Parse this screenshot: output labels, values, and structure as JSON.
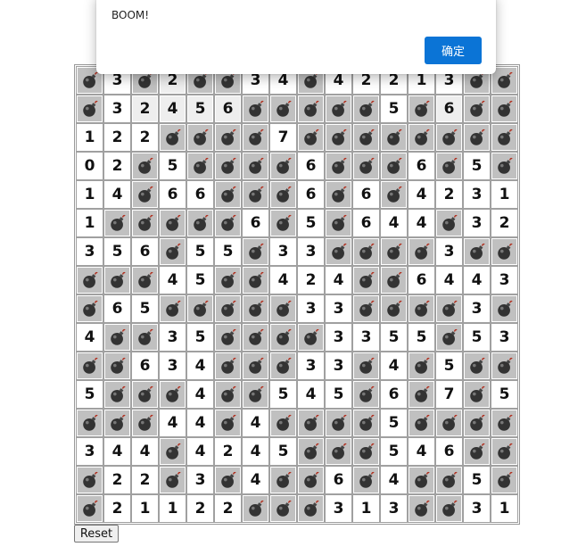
{
  "dialog": {
    "message": "BOOM!",
    "ok_label": "确定"
  },
  "reset_label": "Reset",
  "colors": {
    "bomb_bg": "#c0c0c0",
    "number_bg": "#ffffff",
    "ok_button": "#0b74d6"
  },
  "icons": {
    "bomb": "bomb-icon"
  },
  "board": {
    "rows": [
      [
        "B",
        "3",
        "B",
        "2",
        "B",
        "B",
        "3",
        "4",
        "B",
        "4",
        "2",
        "2",
        "1",
        "3",
        "B",
        "B"
      ],
      [
        "B",
        "3",
        "2",
        "4",
        "5",
        "6",
        "B",
        "B",
        "B",
        "B",
        "B",
        "5",
        "B",
        "6",
        "B",
        "B"
      ],
      [
        "1",
        "2",
        "2",
        "B",
        "B",
        "B",
        "B",
        "7",
        "B",
        "B",
        "B",
        "B",
        "B",
        "B",
        "B",
        "B"
      ],
      [
        "0",
        "2",
        "B",
        "5",
        "B",
        "B",
        "B",
        "B",
        "6",
        "B",
        "B",
        "B",
        "6",
        "B",
        "5",
        "B"
      ],
      [
        "1",
        "4",
        "B",
        "6",
        "6",
        "B",
        "B",
        "B",
        "6",
        "B",
        "6",
        "B",
        "4",
        "2",
        "3",
        "1"
      ],
      [
        "1",
        "B",
        "B",
        "B",
        "B",
        "B",
        "6",
        "B",
        "5",
        "B",
        "6",
        "4",
        "4",
        "B",
        "3",
        "2"
      ],
      [
        "3",
        "5",
        "6",
        "B",
        "5",
        "5",
        "B",
        "3",
        "3",
        "B",
        "B",
        "B",
        "B",
        "3",
        "B",
        "B"
      ],
      [
        "B",
        "B",
        "B",
        "4",
        "5",
        "B",
        "B",
        "4",
        "2",
        "4",
        "B",
        "B",
        "6",
        "4",
        "4",
        "3"
      ],
      [
        "B",
        "6",
        "5",
        "B",
        "B",
        "B",
        "B",
        "B",
        "3",
        "3",
        "B",
        "B",
        "B",
        "B",
        "3",
        "B"
      ],
      [
        "4",
        "B",
        "B",
        "3",
        "5",
        "B",
        "B",
        "B",
        "B",
        "3",
        "3",
        "5",
        "5",
        "B",
        "5",
        "3"
      ],
      [
        "B",
        "B",
        "6",
        "3",
        "4",
        "B",
        "B",
        "B",
        "3",
        "3",
        "B",
        "4",
        "B",
        "5",
        "B",
        "B"
      ],
      [
        "5",
        "B",
        "B",
        "B",
        "4",
        "B",
        "B",
        "5",
        "4",
        "5",
        "B",
        "6",
        "B",
        "7",
        "B",
        "5"
      ],
      [
        "B",
        "B",
        "B",
        "4",
        "4",
        "B",
        "4",
        "B",
        "B",
        "B",
        "B",
        "5",
        "B",
        "B",
        "B",
        "B"
      ],
      [
        "3",
        "4",
        "4",
        "B",
        "4",
        "2",
        "4",
        "5",
        "B",
        "B",
        "B",
        "5",
        "4",
        "6",
        "B",
        "B"
      ],
      [
        "B",
        "2",
        "2",
        "B",
        "3",
        "B",
        "4",
        "B",
        "B",
        "6",
        "B",
        "4",
        "B",
        "B",
        "5",
        "B"
      ],
      [
        "B",
        "2",
        "1",
        "1",
        "2",
        "2",
        "B",
        "B",
        "B",
        "3",
        "1",
        "3",
        "B",
        "B",
        "3",
        "1"
      ]
    ]
  }
}
